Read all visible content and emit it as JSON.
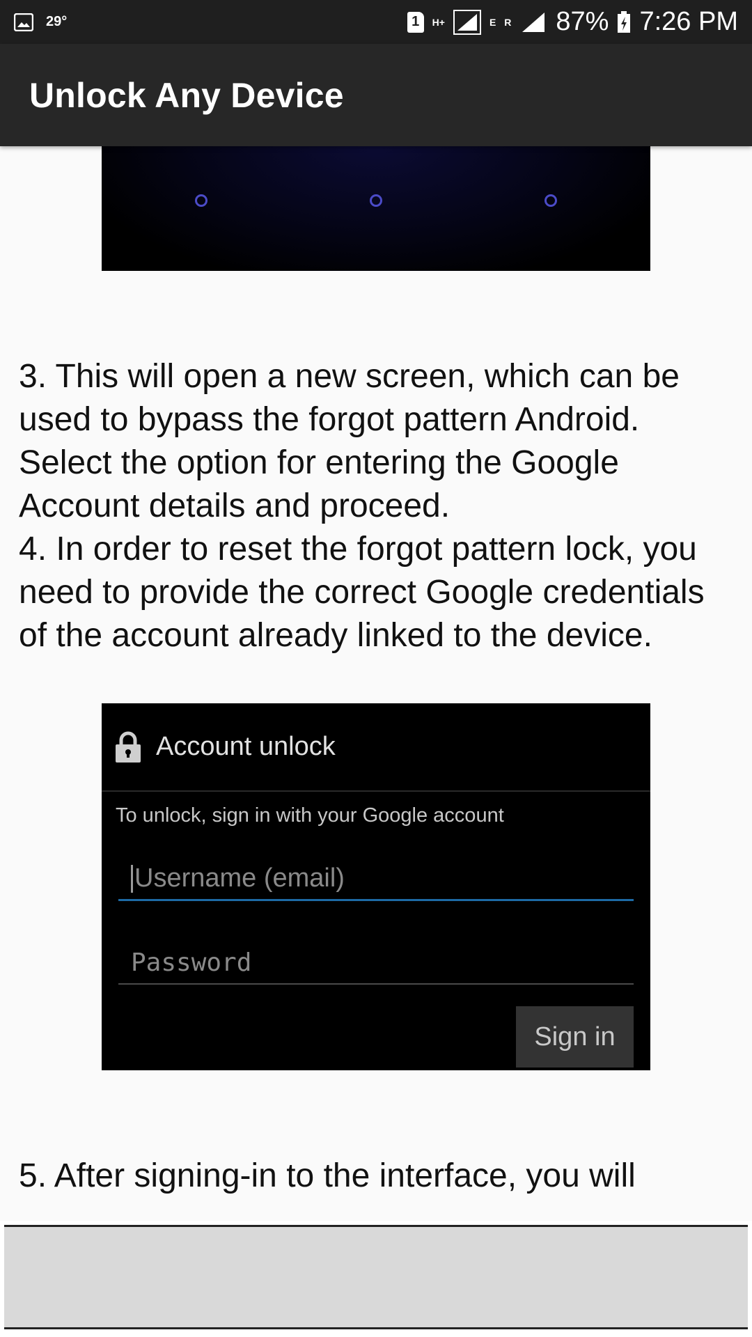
{
  "status_bar": {
    "temperature": "29°",
    "sim_slot": "1",
    "net_primary": "H+",
    "net_secondary": "E",
    "roaming": "R",
    "battery": "87%",
    "time": "7:26 PM"
  },
  "app_bar": {
    "title": "Unlock Any Device"
  },
  "content": {
    "step3": "3. This will open a new screen, which can be used to bypass the forgot pattern Android. Select the option for entering the Google Account details and proceed.",
    "step4": "4. In order to reset the forgot pattern lock, you need to provide the correct Google credentials of the account already linked to the device.",
    "step5": "5. After signing-in to the interface, you will",
    "account_image": {
      "title": "Account unlock",
      "hint": "To unlock, sign in with your Google account",
      "username_placeholder": "Username (email)",
      "password_placeholder": "Password",
      "signin_label": "Sign in"
    }
  },
  "colors": {
    "status_bar_bg": "#1f1f1f",
    "app_bar_bg": "#272727",
    "page_bg": "#fafafa",
    "field_focus": "#1d6aa5"
  }
}
